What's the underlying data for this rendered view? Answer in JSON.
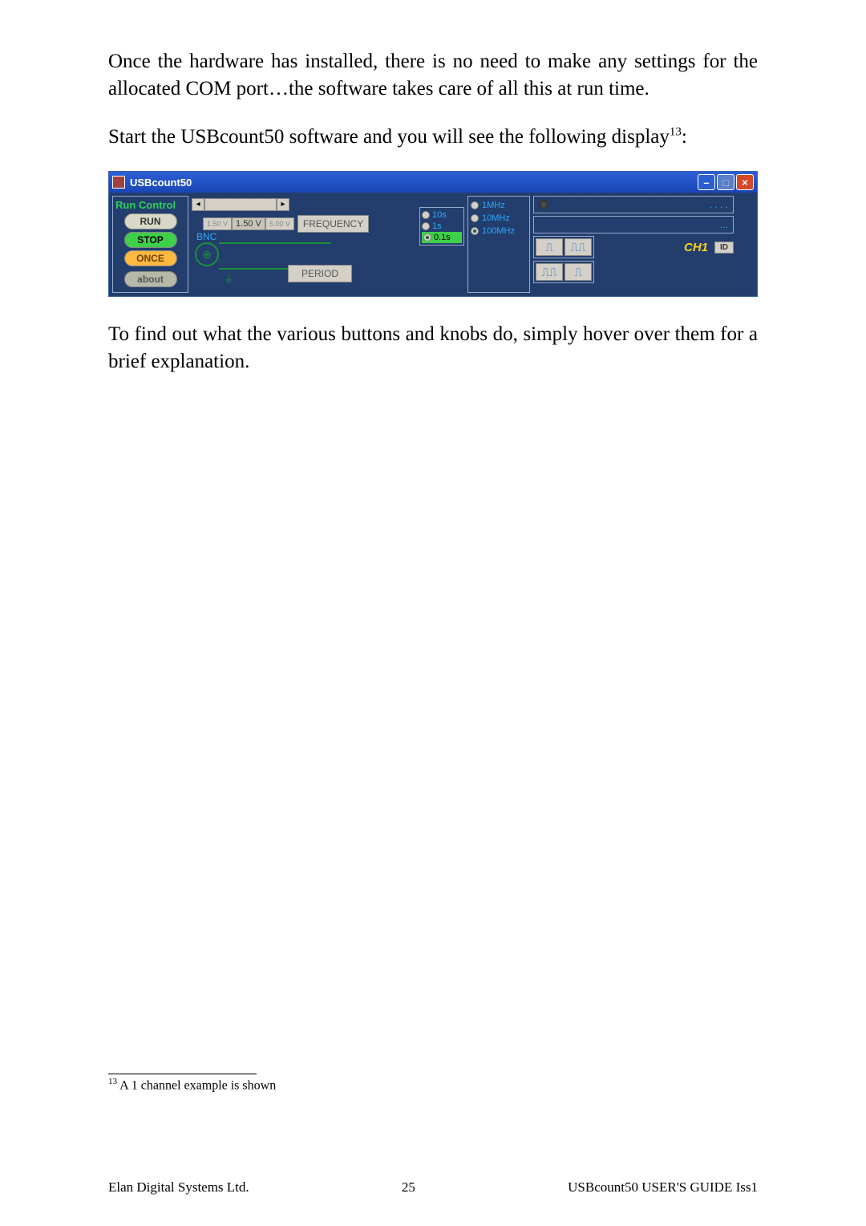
{
  "paragraphs": {
    "p1": "Once the hardware has installed, there is no need to make any settings for the allocated COM port…the software takes care of all this at run time.",
    "p2a": "Start the USBcount50 software and you will see the following display",
    "p2_ref": "13",
    "p2b": ":",
    "p3": "To find out what the various buttons and knobs do, simply hover over them for a brief explanation."
  },
  "window": {
    "title": "USBcount50",
    "min": "–",
    "max": "□",
    "close": "×"
  },
  "run_control": {
    "title": "Run Control",
    "run": "RUN",
    "stop": "STOP",
    "once": "ONCE",
    "about": "about"
  },
  "voltage": {
    "low": "1.50 V",
    "mid": "1.50 V",
    "high": "5.00 V"
  },
  "labels": {
    "frequency": "FREQUENCY",
    "period": "PERIOD",
    "bnc": "BNC"
  },
  "gate_options": {
    "g10s": "10s",
    "g1s": "1s",
    "g01s": "0.1s"
  },
  "mhz_options": {
    "m1": "1MHz",
    "m10": "10MHz",
    "m100": "100MHz"
  },
  "display": {
    "top_dots": ". . . .",
    "bot_dots": "..."
  },
  "channel": {
    "label": "CH1",
    "id": "ID"
  },
  "footnote": {
    "ref": "13",
    "text": " A 1 channel example is shown"
  },
  "footer": {
    "left": "Elan Digital Systems Ltd.",
    "center": "25",
    "right": "USBcount50 USER'S GUIDE Iss1"
  }
}
